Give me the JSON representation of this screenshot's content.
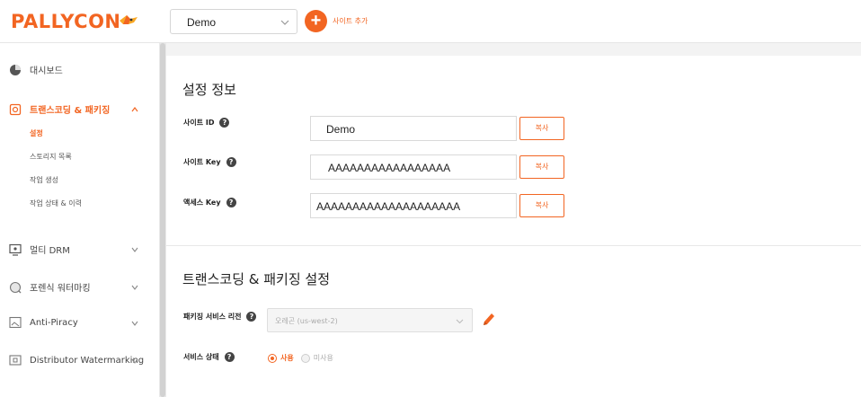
{
  "header": {
    "logo_text": "PALLYCON",
    "site_select_value": "Demo",
    "add_site_label": "사이트 추가"
  },
  "sidebar": {
    "items": [
      {
        "label": "대시보드",
        "icon": "pie-chart-icon"
      },
      {
        "label": "트랜스코딩 & 패키징",
        "icon": "transcoding-icon",
        "active": true
      },
      {
        "label": "멀티 DRM",
        "icon": "monitor-icon"
      },
      {
        "label": "포렌식 워터마킹",
        "icon": "magnifier-icon"
      },
      {
        "label": "Anti-Piracy",
        "icon": "image-icon"
      },
      {
        "label": "Distributor Watermarking",
        "icon": "screen-icon"
      }
    ],
    "subitems": [
      {
        "label": "설정",
        "current": true
      },
      {
        "label": "스토리지 목록"
      },
      {
        "label": "작업 생성"
      },
      {
        "label": "작업 상태 & 이력"
      }
    ]
  },
  "settings": {
    "title": "설정 정보",
    "rows": [
      {
        "label": "사이트 ID",
        "value": "Demo",
        "button": "복사"
      },
      {
        "label": "사이트 Key",
        "value": "AAAAAAAAAAAAAAAAA",
        "button": "복사"
      },
      {
        "label": "액세스 Key",
        "value": "AAAAAAAAAAAAAAAAAAAA",
        "button": "복사"
      }
    ]
  },
  "transcoding": {
    "title": "트랜스코딩 & 패키징 설정",
    "region_label": "패키징 서비스 리전",
    "region_value": "오레곤 (us-west-2)",
    "status_label": "서비스 상태",
    "status_on": "사용",
    "status_off": "미사용"
  },
  "colors": {
    "accent": "#f26522"
  }
}
